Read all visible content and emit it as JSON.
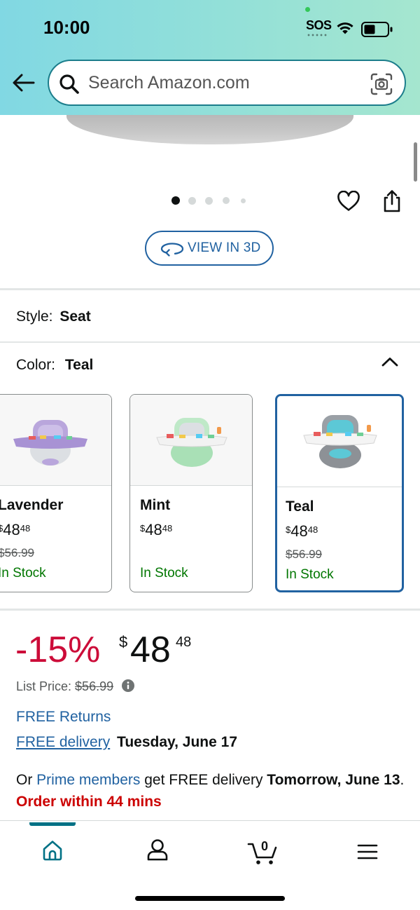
{
  "status_bar": {
    "time": "10:00",
    "sos": "SOS"
  },
  "search": {
    "placeholder": "Search Amazon.com"
  },
  "gallery": {
    "dot_count": 5,
    "active_index": 0
  },
  "view3d": {
    "label": "VIEW IN 3D"
  },
  "style": {
    "label": "Style:",
    "value": "Seat"
  },
  "color": {
    "label": "Color:",
    "value": "Teal"
  },
  "swatches": [
    {
      "name": "Lavender",
      "price_whole": "48",
      "price_fraction": "48",
      "currency": "$",
      "list_price": "$56.99",
      "stock": "In Stock",
      "tint": "#b9a6dc",
      "selected": false
    },
    {
      "name": "Mint",
      "price_whole": "48",
      "price_fraction": "48",
      "currency": "$",
      "list_price": "",
      "stock": "In Stock",
      "tint": "#a9e0b6",
      "selected": false
    },
    {
      "name": "Teal",
      "price_whole": "48",
      "price_fraction": "48",
      "currency": "$",
      "list_price": "$56.99",
      "stock": "In Stock",
      "tint": "#5cc8d6",
      "selected": true
    }
  ],
  "price": {
    "discount": "-15%",
    "currency": "$",
    "whole": "48",
    "fraction": "48"
  },
  "list_price": {
    "label": "List Price:",
    "value": "$56.99"
  },
  "free_returns": "FREE Returns",
  "delivery": {
    "link": "FREE delivery",
    "date": "Tuesday, June 17"
  },
  "prime": {
    "prefix": "Or",
    "link": "Prime members",
    "middle": "get FREE delivery",
    "date": "Tomorrow, June 13",
    "period": ".",
    "urgency": "Order within 44 mins"
  },
  "bottom_nav": {
    "cart_count": "0"
  },
  "colors": {
    "link": "#2162a1",
    "discount": "#cc0c39",
    "stock": "#007600",
    "nav_active": "#007185"
  }
}
